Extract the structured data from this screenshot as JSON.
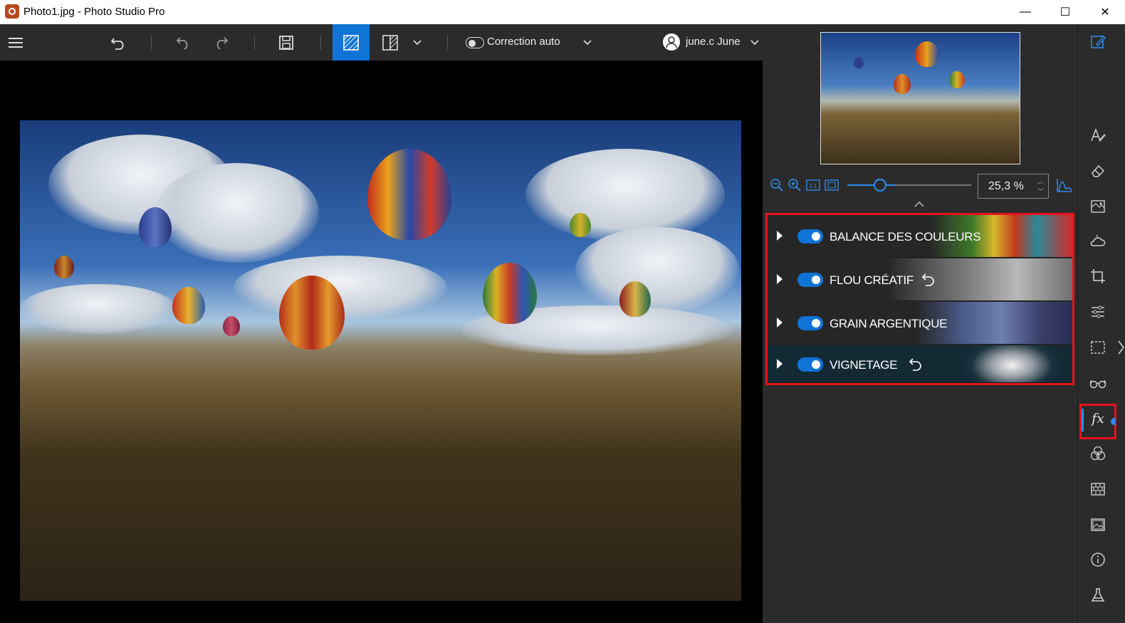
{
  "window": {
    "title": "Photo1.jpg - Photo Studio Pro",
    "controls": {
      "minimize": "—",
      "maximize": "☐",
      "close": "✕"
    }
  },
  "toolbar": {
    "auto_correction_label": "Correction auto",
    "auto_correction_on": false,
    "user_name": "june.c June"
  },
  "navigator": {
    "zoom_value": "25,3 %",
    "zoom_fraction": 0.21
  },
  "effects": [
    {
      "label": "BALANCE DES COULEURS",
      "enabled": true,
      "has_reset": false
    },
    {
      "label": "FLOU CRÉATIF",
      "enabled": true,
      "has_reset": true
    },
    {
      "label": "GRAIN ARGENTIQUE",
      "enabled": true,
      "has_reset": false
    },
    {
      "label": "VIGNETAGE",
      "enabled": true,
      "has_reset": true
    }
  ],
  "sidebar": {
    "tools": [
      "edit-icon",
      "text-icon",
      "eraser-icon",
      "texture-icon",
      "weather-icon",
      "crop-icon",
      "adjust-icon",
      "selection-icon",
      "glasses-icon",
      "fx-icon",
      "color-circles-icon",
      "brick-icon",
      "image-icon",
      "info-icon",
      "flask-icon"
    ],
    "fx_label": "fx"
  },
  "colors": {
    "accent": "#0f74d6",
    "highlight": "#e8121c",
    "panel": "#2b2b2b"
  }
}
